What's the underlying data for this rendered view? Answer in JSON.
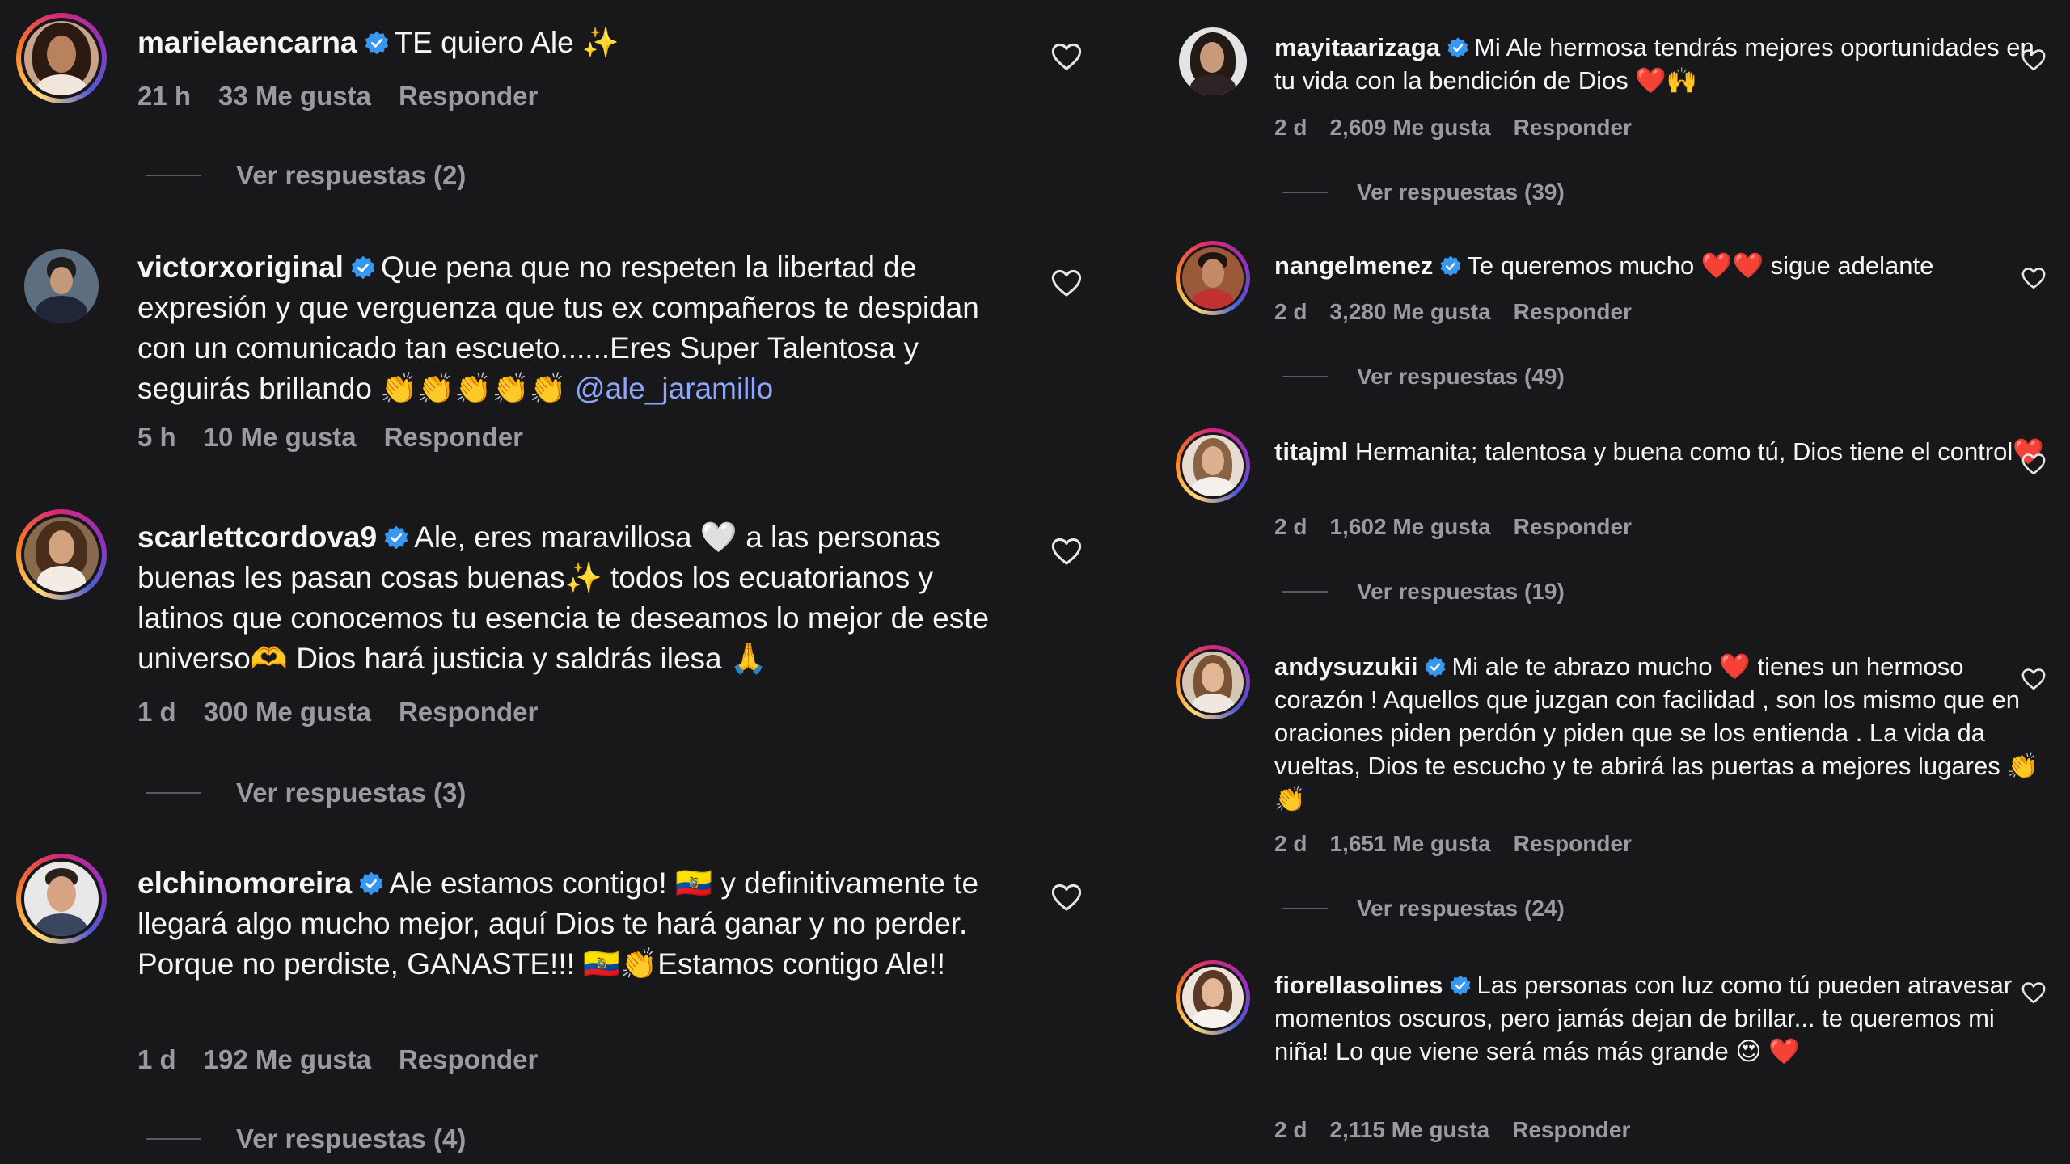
{
  "colors": {
    "background": "#18181b",
    "text": "#f5f5f5",
    "muted": "#9a9aa0",
    "mention": "#8ea6ff",
    "verified": "#3897f0",
    "heart_emoji": "#e0245e"
  },
  "icons": {
    "verified": "verified-badge-icon",
    "like": "heart-outline-icon"
  },
  "left_comments": [
    {
      "username": "marielaencarna",
      "verified": true,
      "text": "TE quiero Ale ✨",
      "time": "21 h",
      "likes": "33 Me gusta",
      "reply_label": "Responder",
      "replies_label": "Ver respuestas (2)"
    },
    {
      "username": "victorxoriginal",
      "verified": true,
      "text": "Que pena que no respeten la libertad de expresión y que verguenza que tus ex compañeros te despidan con un comunicado tan escueto......Eres Super Talentosa y seguirás brillando 👏👏👏👏👏",
      "mention": "@ale_jaramillo",
      "time": "5 h",
      "likes": "10 Me gusta",
      "reply_label": "Responder"
    },
    {
      "username": "scarlettcordova9",
      "verified": true,
      "text": "Ale, eres maravillosa 🤍 a las personas buenas les pasan cosas buenas✨ todos los ecuatorianos y latinos que conocemos tu esencia te deseamos lo mejor de este universo🫶 Dios hará justicia y saldrás ilesa 🙏",
      "time": "1 d",
      "likes": "300 Me gusta",
      "reply_label": "Responder",
      "replies_label": "Ver respuestas (3)"
    },
    {
      "username": "elchinomoreira",
      "verified": true,
      "text": "Ale estamos contigo! 🇪🇨 y definitivamente te llegará algo mucho mejor, aquí Dios te hará ganar y no perder. Porque no perdiste, GANASTE!!! 🇪🇨👏Estamos contigo Ale!!",
      "time": "1 d",
      "likes": "192 Me gusta",
      "reply_label": "Responder",
      "replies_label": "Ver respuestas (4)"
    }
  ],
  "right_comments": [
    {
      "username": "mayitaarizaga",
      "verified": true,
      "text": "Mi Ale hermosa tendrás mejores oportunidades en tu vida con la bendición de Dios ❤️🙌",
      "time": "2 d",
      "likes": "2,609 Me gusta",
      "reply_label": "Responder",
      "replies_label": "Ver respuestas (39)"
    },
    {
      "username": "nangelmenez",
      "verified": true,
      "text": "Te queremos mucho ❤️❤️ sigue adelante",
      "time": "2 d",
      "likes": "3,280 Me gusta",
      "reply_label": "Responder",
      "replies_label": "Ver respuestas (49)"
    },
    {
      "username": "titajml",
      "verified": false,
      "text": "Hermanita; talentosa y buena como tú, Dios tiene el control❤️",
      "time": "2 d",
      "likes": "1,602 Me gusta",
      "reply_label": "Responder",
      "replies_label": "Ver respuestas (19)"
    },
    {
      "username": "andysuzukii",
      "verified": true,
      "text": "Mi ale te abrazo mucho ❤️ tienes un hermoso corazón ! Aquellos que juzgan con facilidad , son los mismo que en oraciones piden perdón y piden que se los entienda . La vida da vueltas, Dios te escucho y te abrirá las puertas a mejores lugares 👏👏",
      "time": "2 d",
      "likes": "1,651 Me gusta",
      "reply_label": "Responder",
      "replies_label": "Ver respuestas (24)"
    },
    {
      "username": "fiorellasolines",
      "verified": true,
      "text": "Las personas con luz como tú pueden atravesar momentos oscuros, pero jamás dejan de brillar... te queremos mi niña! Lo que viene será más más grande 😍 ❤️",
      "time": "2 d",
      "likes": "2,115 Me gusta",
      "reply_label": "Responder"
    }
  ]
}
